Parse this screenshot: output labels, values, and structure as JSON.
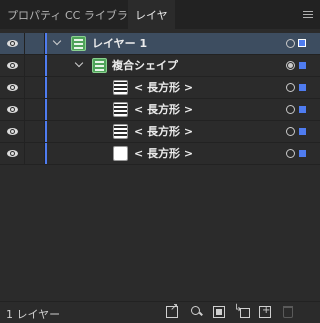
{
  "tabs": [
    {
      "label": "プロパティ"
    },
    {
      "label": "CC ライブラリ"
    },
    {
      "label": "レイヤー"
    }
  ],
  "menu_icon": "hamburger-menu-icon",
  "colors": {
    "panel_bg": "#2b2b2b",
    "tabbar_bg": "#222222",
    "selected_row": "#3d4d60",
    "layer_color": "#4f7cf0",
    "group_thumb": "#4fa35a"
  },
  "layers": [
    {
      "name": "レイヤー 1",
      "kind": "layer",
      "expanded": true,
      "selected": true
    },
    {
      "name": "複合シェイプ",
      "kind": "compound-shape",
      "expanded": true
    },
    {
      "name": "< 長方形 >",
      "kind": "rectangle"
    },
    {
      "name": "< 長方形 >",
      "kind": "rectangle"
    },
    {
      "name": "< 長方形 >",
      "kind": "rectangle"
    },
    {
      "name": "< 長方形 >",
      "kind": "rectangle"
    }
  ],
  "footer": {
    "count_label": "1 レイヤー",
    "icons": [
      "export-icon",
      "search-icon",
      "clipping-mask-icon",
      "new-sublayer-icon",
      "new-layer-icon",
      "trash-icon"
    ]
  }
}
